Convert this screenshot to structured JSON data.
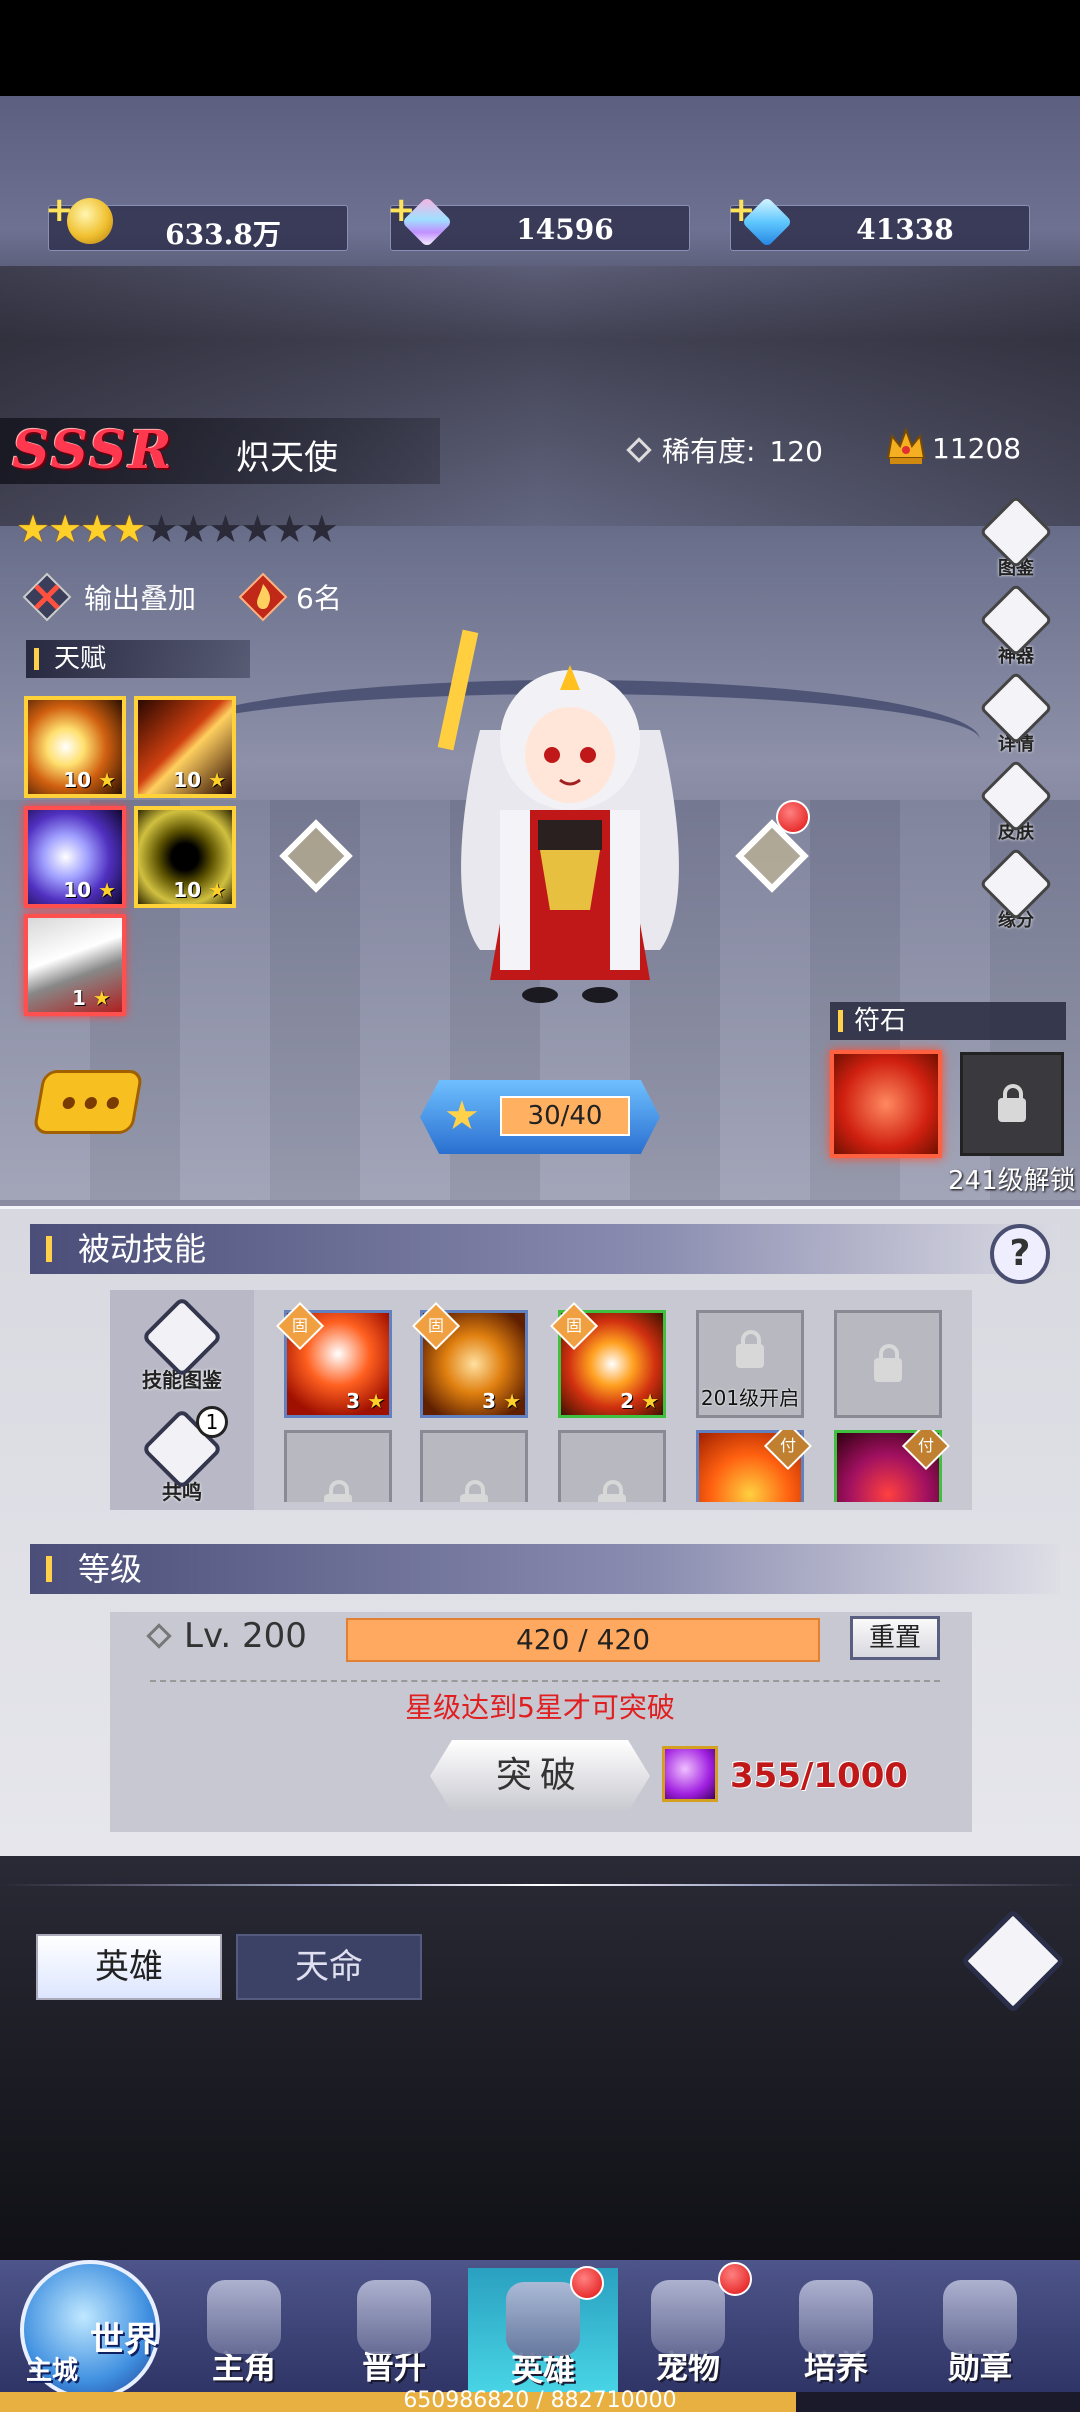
{
  "resources": [
    {
      "icon": "gold-coin-icon",
      "value": "633.8万"
    },
    {
      "icon": "rainbow-diamond-icon",
      "value": "14596"
    },
    {
      "icon": "blue-diamond-icon",
      "value": "41338"
    }
  ],
  "hero": {
    "grade": "SSSR",
    "name": "炽天使",
    "rarity_label": "稀有度:",
    "rarity_value": "120",
    "power": "11208",
    "stars_filled": 4,
    "stars_total": 10,
    "role_tag": "输出叠加",
    "rank_tag": "6名"
  },
  "talent": {
    "title": "天赋",
    "items": [
      {
        "icon": "claw-slash-icon",
        "level": "10"
      },
      {
        "icon": "fire-blade-icon",
        "level": "10"
      },
      {
        "icon": "moon-slash-icon",
        "level": "10"
      },
      {
        "icon": "shadow-figure-icon",
        "level": "10"
      },
      {
        "icon": "spear-icon",
        "level": "1"
      }
    ]
  },
  "side_menu": [
    "图鉴",
    "神器",
    "详情",
    "皮肤",
    "缘分"
  ],
  "star_progress": "30/40",
  "rune": {
    "title": "符石",
    "unlock_text": "241级解锁"
  },
  "passive": {
    "title": "被动技能",
    "side": [
      {
        "icon": "skill-codex-icon",
        "label": "技能图鉴"
      },
      {
        "icon": "resonance-icon",
        "label": "共鸣",
        "badge": "1"
      }
    ],
    "fixed_badge": "固",
    "grade_badge": "付",
    "skills": [
      {
        "icon": "sword-skill-icon",
        "level": "3",
        "state": "fixed"
      },
      {
        "icon": "shield-burst-icon",
        "level": "3",
        "state": "fixed"
      },
      {
        "icon": "fire-explosion-icon",
        "level": "2",
        "state": "fixed"
      },
      {
        "icon": "lock-icon",
        "text": "201级开启",
        "state": "locked"
      },
      {
        "icon": "lock-icon",
        "state": "locked"
      },
      {
        "icon": "lock-icon",
        "state": "locked"
      },
      {
        "icon": "lock-icon",
        "state": "locked"
      },
      {
        "icon": "lock-icon",
        "state": "locked"
      },
      {
        "icon": "fire-beast-icon",
        "state": "grade"
      },
      {
        "icon": "red-claws-icon",
        "state": "grade"
      }
    ]
  },
  "level": {
    "title": "等级",
    "label": "Lv. 200",
    "exp": "420 / 420",
    "exp_fraction": 1.0,
    "reset_label": "重置",
    "warning": "星级达到5星才可突破",
    "break_label": "突破",
    "material": "355/1000"
  },
  "tabs": [
    {
      "label": "英雄",
      "selected": true
    },
    {
      "label": "天命",
      "selected": false
    }
  ],
  "nav": {
    "world_label": "世界",
    "world_sub": "主城",
    "items": [
      {
        "label": "主角",
        "badge": false
      },
      {
        "label": "晋升",
        "badge": false
      },
      {
        "label": "英雄",
        "badge": true,
        "active": true
      },
      {
        "label": "宠物",
        "badge": true
      },
      {
        "label": "培养",
        "badge": false
      },
      {
        "label": "勋章",
        "badge": false
      }
    ]
  },
  "exp_bar": {
    "text": "650986820 / 882710000",
    "fraction": 0.737
  }
}
